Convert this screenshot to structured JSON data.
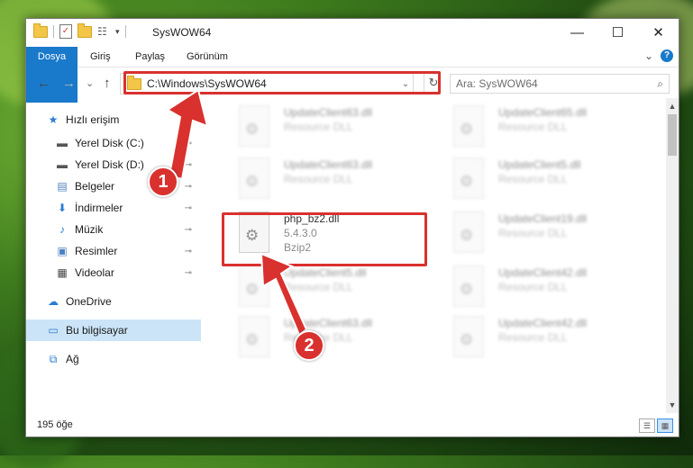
{
  "window": {
    "title": "SysWOW64"
  },
  "titlebar": {
    "minimize": "—",
    "maximize": "☐",
    "close": "✕"
  },
  "ribbon": {
    "tabs": [
      "Dosya",
      "Giriş",
      "Paylaş",
      "Görünüm"
    ],
    "expand": "⌄",
    "help": "?"
  },
  "nav": {
    "back": "←",
    "forward": "→",
    "recent": "⌄",
    "up": "↑",
    "address": "C:\\Windows\\SysWOW64",
    "refresh": "↻",
    "search_placeholder": "Ara: SysWOW64"
  },
  "sidebar": {
    "items": [
      {
        "label": "Hızlı erişim",
        "icon": "star-icon",
        "glyph": "★",
        "color": "#2b7cd3"
      },
      {
        "label": "Yerel Disk (C:)",
        "icon": "drive-icon",
        "glyph": "▬",
        "color": "#555555",
        "pinned": true
      },
      {
        "label": "Yerel Disk (D:)",
        "icon": "drive-icon",
        "glyph": "▬",
        "color": "#555555",
        "pinned": true
      },
      {
        "label": "Belgeler",
        "icon": "documents-icon",
        "glyph": "▤",
        "color": "#4d7fbf",
        "pinned": true
      },
      {
        "label": "İndirmeler",
        "icon": "download-icon",
        "glyph": "⬇",
        "color": "#2b7cd3",
        "pinned": true
      },
      {
        "label": "Müzik",
        "icon": "music-icon",
        "glyph": "♪",
        "color": "#2b7cd3",
        "pinned": true
      },
      {
        "label": "Resimler",
        "icon": "pictures-icon",
        "glyph": "▣",
        "color": "#4d7fbf",
        "pinned": true
      },
      {
        "label": "Videolar",
        "icon": "video-icon",
        "glyph": "▦",
        "color": "#444444",
        "pinned": true
      },
      {
        "label": "OneDrive",
        "icon": "cloud-icon",
        "glyph": "☁",
        "color": "#2b7cd3"
      },
      {
        "label": "Bu bilgisayar",
        "icon": "computer-icon",
        "glyph": "▭",
        "color": "#2b7cd3",
        "selected": true
      },
      {
        "label": "Ağ",
        "icon": "network-icon",
        "glyph": "⧉",
        "color": "#2b7cd3"
      }
    ]
  },
  "files": [
    {
      "name": "UpdateClient63.dll",
      "sub1": "Resource DLL",
      "sub2": "",
      "blurred": true
    },
    {
      "name": "UpdateClient65.dll",
      "sub1": "Resource DLL",
      "sub2": "",
      "blurred": true
    },
    {
      "name": "UpdateClient63.dll",
      "sub1": "Resource DLL",
      "sub2": "",
      "blurred": true
    },
    {
      "name": "UpdateClient5.dll",
      "sub1": "Resource DLL",
      "sub2": "",
      "blurred": true
    },
    {
      "name": "php_bz2.dll",
      "sub1": "5.4.3.0",
      "sub2": "Bzip2",
      "blurred": false
    },
    {
      "name": "UpdateClient19.dll",
      "sub1": "Resource DLL",
      "sub2": "",
      "blurred": true
    },
    {
      "name": "UpdateClient5.dll",
      "sub1": "Resource DLL",
      "sub2": "",
      "blurred": true
    },
    {
      "name": "UpdateClient42.dll",
      "sub1": "Resource DLL",
      "sub2": "",
      "blurred": true
    },
    {
      "name": "UpdateClient63.dll",
      "sub1": "Resource DLL",
      "sub2": "",
      "blurred": true
    },
    {
      "name": "UpdateClient42.dll",
      "sub1": "Resource DLL",
      "sub2": "",
      "blurred": true
    }
  ],
  "status": {
    "count": "195 öğe"
  },
  "callouts": {
    "one": "1",
    "two": "2"
  },
  "colors": {
    "highlight": "#d9312e",
    "accent": "#1979ca"
  }
}
